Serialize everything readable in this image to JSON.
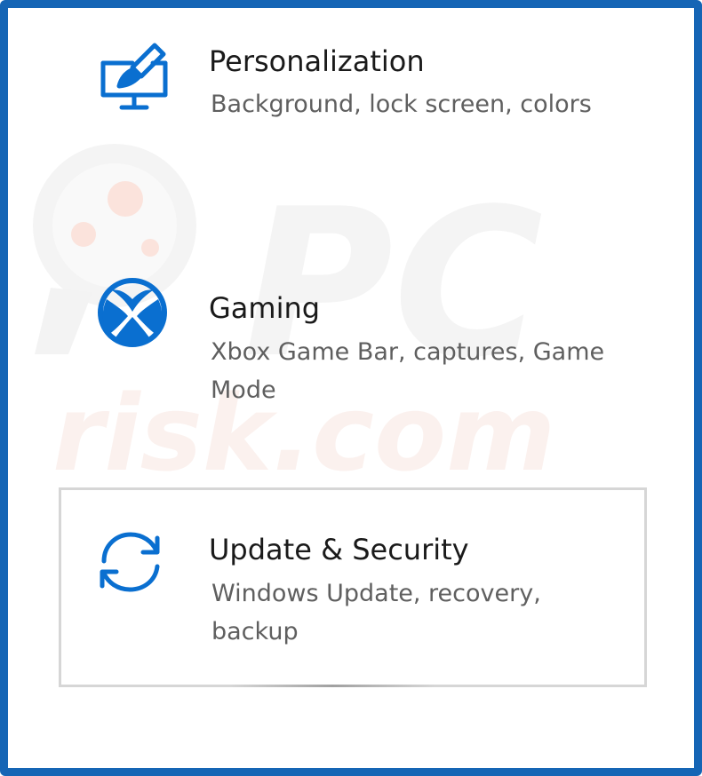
{
  "settings": {
    "items": [
      {
        "title": "Personalization",
        "description": "Background, lock screen, colors",
        "icon": "personalization-icon"
      },
      {
        "title": "Gaming",
        "description": "Xbox Game Bar, captures, Game Mode",
        "icon": "xbox-icon"
      },
      {
        "title": "Update & Security",
        "description": "Windows Update, recovery, backup",
        "icon": "update-sync-icon"
      }
    ]
  },
  "watermark": {
    "text": "PC risk.com"
  },
  "colors": {
    "accent": "#0a6fd0",
    "frame_border": "#1565b5",
    "title_text": "#1a1a1a",
    "description_text": "#5f5f5f",
    "selection_border": "#d6d6d6"
  }
}
